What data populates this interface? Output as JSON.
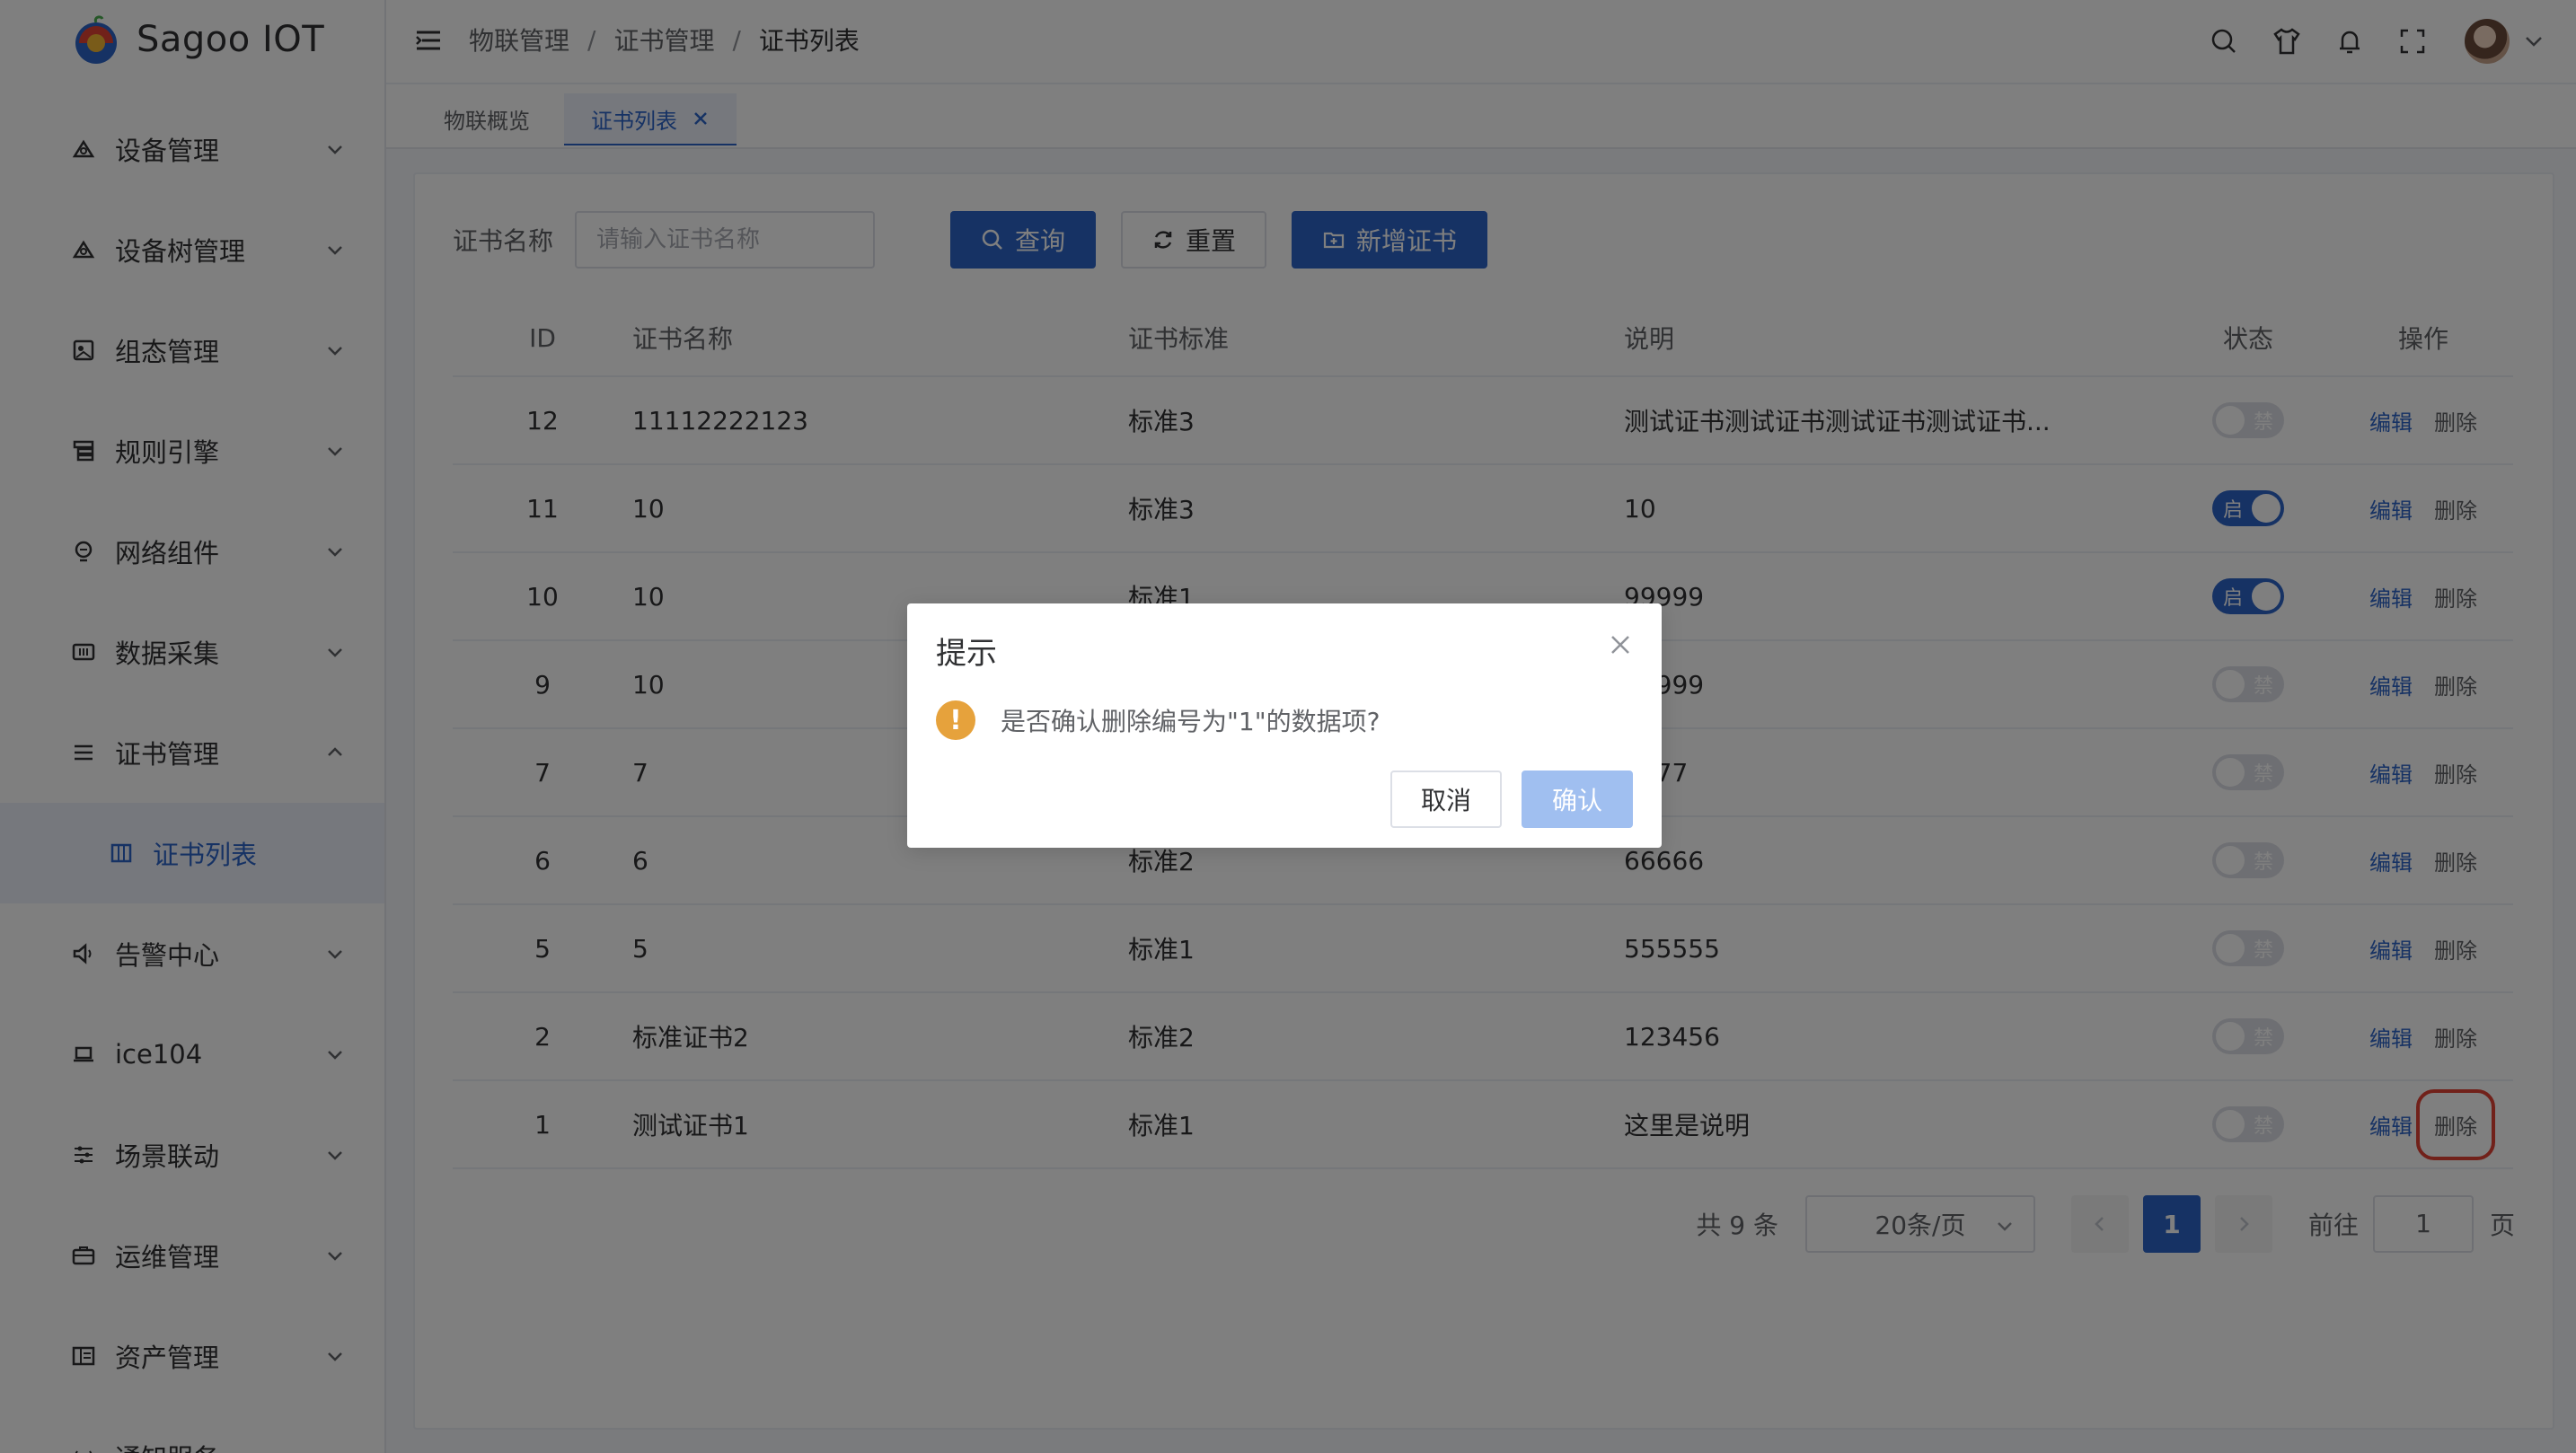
{
  "app": {
    "title": "Sagoo IOT"
  },
  "sidebar": {
    "items": [
      {
        "label": "设备管理",
        "icon": "devices-icon",
        "expanded": false
      },
      {
        "label": "设备树管理",
        "icon": "device-tree-icon",
        "expanded": false
      },
      {
        "label": "组态管理",
        "icon": "topology-icon",
        "expanded": false
      },
      {
        "label": "规则引擎",
        "icon": "rule-engine-icon",
        "expanded": false
      },
      {
        "label": "网络组件",
        "icon": "network-icon",
        "expanded": false
      },
      {
        "label": "数据采集",
        "icon": "data-collect-icon",
        "expanded": false
      },
      {
        "label": "证书管理",
        "icon": "list-icon",
        "expanded": true
      },
      {
        "label": "告警中心",
        "icon": "speaker-icon",
        "expanded": false
      },
      {
        "label": "ice104",
        "icon": "laptop-icon",
        "expanded": false
      },
      {
        "label": "场景联动",
        "icon": "sliders-icon",
        "expanded": false
      },
      {
        "label": "运维管理",
        "icon": "briefcase-icon",
        "expanded": false
      },
      {
        "label": "资产管理",
        "icon": "asset-icon",
        "expanded": false
      },
      {
        "label": "通知服务",
        "icon": "notice-icon",
        "expanded": false
      }
    ],
    "subitem": {
      "label": "证书列表",
      "icon": "grid-icon"
    }
  },
  "header": {
    "breadcrumb": [
      "物联管理",
      "证书管理",
      "证书列表"
    ],
    "separator": "/"
  },
  "tabs": [
    {
      "label": "物联概览",
      "active": false
    },
    {
      "label": "证书列表",
      "active": true
    }
  ],
  "search": {
    "label": "证书名称",
    "placeholder": "请输入证书名称",
    "query_label": "查询",
    "reset_label": "重置",
    "add_label": "新增证书"
  },
  "table": {
    "columns": [
      "ID",
      "证书名称",
      "证书标准",
      "说明",
      "状态",
      "操作"
    ],
    "rows": [
      {
        "id": "12",
        "name": "11112222123",
        "std": "标准3",
        "desc": "测试证书测试证书测试证书测试证书...",
        "on": false
      },
      {
        "id": "11",
        "name": "10",
        "std": "标准3",
        "desc": "10",
        "on": true
      },
      {
        "id": "10",
        "name": "10",
        "std": "标准1",
        "desc": "99999",
        "on": true
      },
      {
        "id": "9",
        "name": "10",
        "std": "",
        "desc": "99999",
        "on": false
      },
      {
        "id": "7",
        "name": "7",
        "std": "",
        "desc": "7777",
        "on": false
      },
      {
        "id": "6",
        "name": "6",
        "std": "标准2",
        "desc": "66666",
        "on": false
      },
      {
        "id": "5",
        "name": "5",
        "std": "标准1",
        "desc": "555555",
        "on": false
      },
      {
        "id": "2",
        "name": "标准证书2",
        "std": "标准2",
        "desc": "123456",
        "on": false
      },
      {
        "id": "1",
        "name": "测试证书1",
        "std": "标准1",
        "desc": "这里是说明",
        "on": false
      }
    ],
    "switch_on_text": "启",
    "switch_off_text": "禁",
    "edit_label": "编辑",
    "delete_label": "删除"
  },
  "pagination": {
    "total_text": "共 9 条",
    "page_size": "20条/页",
    "current_page": "1",
    "goto_label": "前往",
    "goto_value": "1",
    "page_unit": "页"
  },
  "dialog": {
    "title": "提示",
    "message": "是否确认删除编号为\"1\"的数据项?",
    "cancel_label": "取消",
    "confirm_label": "确认"
  },
  "colors": {
    "primary": "#2d64c8",
    "primary_light": "#a0bff0",
    "warning": "#e6a23c",
    "highlight": "#e34234"
  }
}
